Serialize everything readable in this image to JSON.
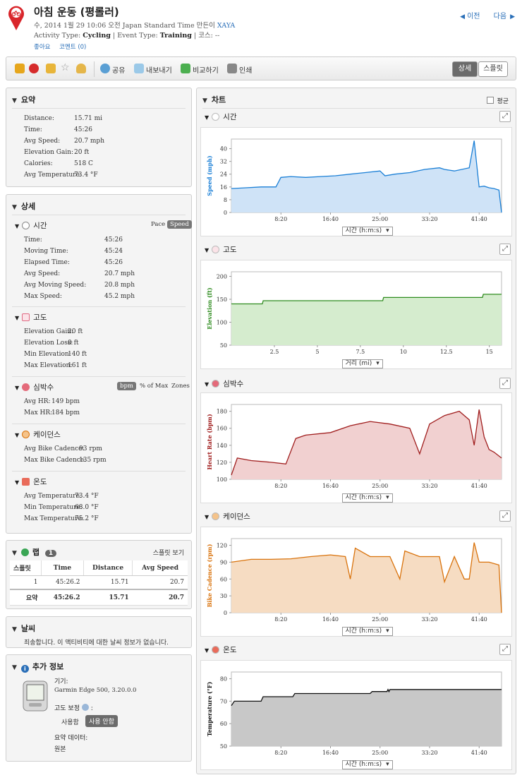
{
  "header": {
    "title": "아침 운동 (평롤러)",
    "date_line_prefix": "수, 2014 1월 29 10:06 오전 Japan Standard Time 만든이",
    "author": "XAYA",
    "activity_type_label": "Activity Type:",
    "activity_type": "Cycling",
    "event_type_label": "Event Type:",
    "event_type": "Training",
    "course_text": "코스: --",
    "like_link": "좋아요",
    "comments_link": "코멘트 (0)",
    "prev_label": "이전",
    "next_label": "다음"
  },
  "toolbar": {
    "share": "공유",
    "export": "내보내기",
    "compare": "비교하기",
    "print": "인쇄",
    "view_detail": "상세",
    "view_split": "스플릿"
  },
  "summary": {
    "title": "요약",
    "rows": [
      {
        "label": "Distance:",
        "value": "15.71 mi"
      },
      {
        "label": "Time:",
        "value": "45:26"
      },
      {
        "label": "Avg Speed:",
        "value": "20.7 mph"
      },
      {
        "label": "Elevation Gain:",
        "value": "20 ft"
      },
      {
        "label": "Calories:",
        "value": "518 C"
      },
      {
        "label": "Avg Temperature:",
        "value": "73.4 °F"
      }
    ]
  },
  "details": {
    "title": "상세",
    "time": {
      "title": "시간",
      "toggle_pace": "Pace",
      "toggle_speed": "Speed",
      "rows": [
        {
          "label": "Time:",
          "value": "45:26"
        },
        {
          "label": "Moving Time:",
          "value": "45:24"
        },
        {
          "label": "Elapsed Time:",
          "value": "45:26"
        },
        {
          "label": "Avg Speed:",
          "value": "20.7 mph"
        },
        {
          "label": "Avg Moving Speed:",
          "value": "20.8 mph"
        },
        {
          "label": "Max Speed:",
          "value": "45.2 mph"
        }
      ]
    },
    "elevation": {
      "title": "고도",
      "rows": [
        {
          "label": "Elevation Gain:",
          "value": "20 ft"
        },
        {
          "label": "Elevation Loss:",
          "value": "0 ft"
        },
        {
          "label": "Min Elevation:",
          "value": "140 ft"
        },
        {
          "label": "Max Elevation:",
          "value": "161 ft"
        }
      ]
    },
    "heart_rate": {
      "title": "심박수",
      "toggle_bpm": "bpm",
      "toggle_pct": "% of Max",
      "toggle_zones": "Zones",
      "rows": [
        {
          "label": "Avg HR:",
          "value": "149 bpm"
        },
        {
          "label": "Max HR:",
          "value": "184 bpm"
        }
      ]
    },
    "cadence": {
      "title": "케이던스",
      "rows": [
        {
          "label": "Avg Bike Cadence:",
          "value": "93 rpm"
        },
        {
          "label": "Max Bike Cadence:",
          "value": "135 rpm"
        }
      ]
    },
    "temperature": {
      "title": "온도",
      "rows": [
        {
          "label": "Avg Temperature:",
          "value": "73.4 °F"
        },
        {
          "label": "Min Temperature:",
          "value": "68.0 °F"
        },
        {
          "label": "Max Temperature:",
          "value": "75.2 °F"
        }
      ]
    }
  },
  "laps": {
    "title": "랩",
    "count": "1",
    "view_splits": "스플릿 보기",
    "columns": [
      "스플릿",
      "Time",
      "Distance",
      "Avg Speed"
    ],
    "rows": [
      [
        "1",
        "45:26.2",
        "15.71",
        "20.7"
      ]
    ],
    "total": [
      "요약",
      "45:26.2",
      "15.71",
      "20.7"
    ]
  },
  "weather": {
    "title": "날씨",
    "message": "죄송합니다. 이 액티비티에 대한 날씨 정보가 없습니다."
  },
  "more_info": {
    "title": "추가 정보",
    "device_label": "기기:",
    "device": "Garmin Edge 500, 3.20.0.0",
    "elev_correction_label": "고도 보정",
    "elev_on": "사용함",
    "elev_off": "사용 안함",
    "summary_data_label": "요약 데이터:",
    "summary_data_value": "원본"
  },
  "charts_panel": {
    "title": "차트",
    "average_label": "평균",
    "time_axis_select": "시간 (h:m:s)",
    "distance_axis_select": "거리 (mi)"
  },
  "chart_data": [
    {
      "id": "speed",
      "type": "area",
      "section_title": "시간",
      "ylabel": "Speed (mph)",
      "color": "#1a7fd6",
      "fill": "#cfe3f7",
      "x_ticks": [
        "8:20",
        "16:40",
        "25:00",
        "33:20",
        "41:40"
      ],
      "y_ticks": [
        "0",
        "8",
        "16",
        "24",
        "32",
        "40"
      ],
      "ylim": [
        0,
        46
      ],
      "xlim_seconds": [
        0,
        2726
      ],
      "x_seconds": [
        0,
        150,
        300,
        450,
        500,
        600,
        750,
        900,
        1050,
        1200,
        1350,
        1500,
        1550,
        1650,
        1800,
        1950,
        2100,
        2150,
        2250,
        2400,
        2450,
        2500,
        2550,
        2600,
        2650,
        2700,
        2726
      ],
      "values": [
        15,
        15.5,
        16,
        16,
        22,
        22.5,
        22,
        22.5,
        23,
        24,
        25,
        26,
        23,
        24,
        25,
        27,
        28,
        27,
        26,
        28,
        45,
        16,
        16.5,
        15.5,
        15,
        14,
        0
      ]
    },
    {
      "id": "elevation",
      "type": "area",
      "section_title": "고도",
      "ylabel": "Elevation (ft)",
      "color": "#2e8b1e",
      "fill": "#d5ecce",
      "x_ticks": [
        "2.5",
        "5",
        "7.5",
        "10",
        "12.5",
        "15"
      ],
      "y_ticks": [
        "50",
        "100",
        "150",
        "200"
      ],
      "ylim": [
        50,
        210
      ],
      "xlim_miles": [
        0,
        15.71
      ],
      "x_miles": [
        0,
        1.8,
        1.85,
        8.8,
        8.85,
        14.6,
        14.65,
        15.71
      ],
      "values": [
        140,
        140,
        147,
        147,
        154,
        154,
        161,
        161
      ]
    },
    {
      "id": "heart_rate",
      "type": "area",
      "section_title": "심박수",
      "ylabel": "Heart Rate (bpm)",
      "color": "#a01e1e",
      "fill": "#f1d0d0",
      "x_ticks": [
        "8:20",
        "16:40",
        "25:00",
        "33:20",
        "41:40"
      ],
      "y_ticks": [
        "100",
        "120",
        "140",
        "160",
        "180"
      ],
      "ylim": [
        100,
        188
      ],
      "xlim_seconds": [
        0,
        2726
      ],
      "x_seconds": [
        0,
        60,
        200,
        400,
        550,
        650,
        750,
        1000,
        1200,
        1400,
        1600,
        1800,
        1900,
        2000,
        2150,
        2300,
        2400,
        2450,
        2500,
        2550,
        2600,
        2650,
        2726
      ],
      "values": [
        105,
        125,
        122,
        120,
        118,
        148,
        152,
        155,
        163,
        168,
        165,
        160,
        130,
        165,
        175,
        180,
        170,
        140,
        182,
        150,
        135,
        132,
        125
      ]
    },
    {
      "id": "cadence",
      "type": "area",
      "section_title": "케이던스",
      "ylabel": "Bike Cadence (rpm)",
      "color": "#d9730d",
      "fill": "#f6dcc2",
      "x_ticks": [
        "8:20",
        "16:40",
        "25:00",
        "33:20",
        "41:40"
      ],
      "y_ticks": [
        "0",
        "30",
        "60",
        "90",
        "120"
      ],
      "ylim": [
        0,
        132
      ],
      "xlim_seconds": [
        0,
        2726
      ],
      "x_seconds": [
        0,
        200,
        400,
        600,
        800,
        1000,
        1150,
        1200,
        1250,
        1400,
        1600,
        1700,
        1750,
        1900,
        2100,
        2150,
        2250,
        2350,
        2400,
        2450,
        2500,
        2600,
        2700,
        2726
      ],
      "values": [
        90,
        95,
        95,
        96,
        100,
        103,
        100,
        60,
        115,
        100,
        100,
        60,
        110,
        100,
        100,
        55,
        100,
        60,
        60,
        125,
        90,
        90,
        85,
        0
      ]
    },
    {
      "id": "temperature",
      "type": "area",
      "section_title": "온도",
      "ylabel": "Temperature (°F)",
      "color": "#111111",
      "fill": "#c8c8c8",
      "x_ticks": [
        "8:20",
        "16:40",
        "25:00",
        "33:20",
        "41:40"
      ],
      "y_ticks": [
        "50",
        "60",
        "70",
        "80"
      ],
      "ylim": [
        50,
        83
      ],
      "xlim_seconds": [
        0,
        2726
      ],
      "x_seconds": [
        0,
        30,
        300,
        320,
        620,
        640,
        1400,
        1420,
        1570,
        1580,
        1590,
        1600,
        2726
      ],
      "values": [
        68,
        70,
        70,
        72,
        72,
        73.4,
        73.4,
        74.3,
        74.3,
        75.2,
        74.3,
        75.2,
        75.2
      ]
    }
  ]
}
